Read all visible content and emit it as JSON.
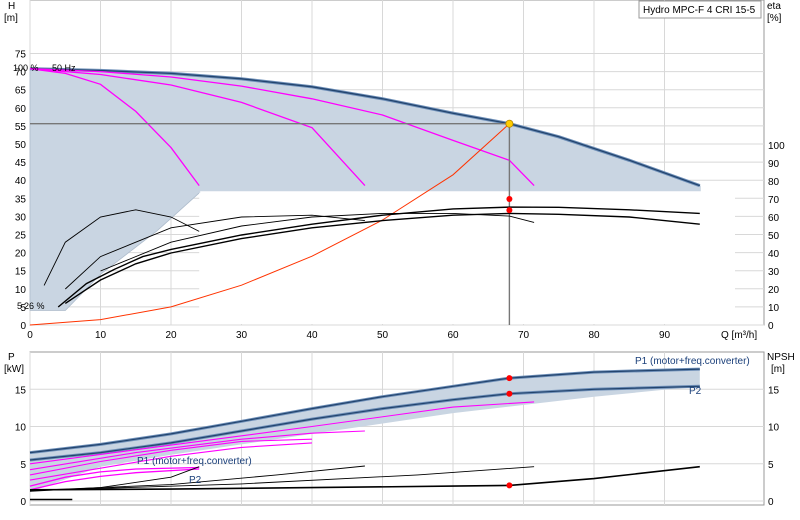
{
  "title": "Hydro MPC-F 4 CRI 15-5",
  "colors": {
    "envelope": "#c9d5e2",
    "envelope_stroke": "#aebccc",
    "main_curve": "#22446e",
    "main_curve_light": "#6e8fb8",
    "reduced_speed": "#ff00ff",
    "system_curve": "#ff3300",
    "eta": "#000000",
    "duty_line": "#777777",
    "duty_point": "#ffcc00",
    "marker": "#ff0000",
    "label_blue": "#1a3f7a",
    "grid": "#d8d8d8"
  },
  "top_panel": {
    "left_label": "H",
    "left_unit": "[m]",
    "right_label": "eta",
    "right_unit": "[%]",
    "x_label": "Q [m³/h]",
    "speed_label": "100 %",
    "freq_label": "50 Hz",
    "min_speed_label": "26 %",
    "min_speed_prefix": "5"
  },
  "bottom_panel": {
    "left_label": "P",
    "left_unit": "[kW]",
    "right_label": "NPSH",
    "right_unit": "[m]",
    "p1_label_top": "P1 (motor+freq.converter)",
    "p2_label_top": "P2",
    "p1_label_low": "P1 (motor+freq.converter)",
    "p2_label_low": "P2"
  },
  "chart_data": [
    {
      "type": "line",
      "name": "head-and-efficiency",
      "x_label": "Q [m³/h]",
      "xlim": [
        0,
        100
      ],
      "x_ticks": [
        0,
        10,
        20,
        30,
        40,
        50,
        60,
        70,
        80,
        90
      ],
      "y_label": "H [m]",
      "ylim": [
        0,
        80
      ],
      "y_ticks": [
        0,
        5,
        10,
        15,
        20,
        25,
        30,
        35,
        40,
        45,
        50,
        55,
        60,
        65,
        70,
        75
      ],
      "y2_label": "eta [%]",
      "y2_range": [
        0,
        100
      ],
      "y2_ticks": [
        0,
        10,
        20,
        30,
        40,
        50,
        60,
        70,
        80,
        90,
        100
      ],
      "duty_point": {
        "q": 68,
        "h": 55.6
      },
      "head_curves": [
        {
          "kind": "full-speed",
          "points": [
            [
              0,
              70.8
            ],
            [
              10,
              70.3
            ],
            [
              20,
              69.5
            ],
            [
              30,
              68.0
            ],
            [
              40,
              65.8
            ],
            [
              50,
              62.5
            ],
            [
              60,
              58.5
            ],
            [
              68,
              55.6
            ],
            [
              75,
              52
            ],
            [
              85,
              45.5
            ],
            [
              95,
              38.5
            ]
          ]
        },
        {
          "kind": "reduced",
          "points": [
            [
              0,
              70.8
            ],
            [
              10,
              70.0
            ],
            [
              20,
              68.5
            ],
            [
              30,
              66.0
            ],
            [
              40,
              62.5
            ],
            [
              50,
              58.0
            ],
            [
              60,
              51.0
            ],
            [
              68,
              45.5
            ],
            [
              71.5,
              38.5
            ]
          ]
        },
        {
          "kind": "reduced",
          "points": [
            [
              0,
              70.8
            ],
            [
              10,
              69.2
            ],
            [
              20,
              66.3
            ],
            [
              30,
              61.5
            ],
            [
              40,
              54.5
            ],
            [
              47.5,
              38.5
            ]
          ]
        },
        {
          "kind": "reduced",
          "points": [
            [
              0,
              70.8
            ],
            [
              5,
              69.5
            ],
            [
              10,
              66.5
            ],
            [
              15,
              59.0
            ],
            [
              20,
              49.0
            ],
            [
              24,
              38.5
            ]
          ]
        }
      ],
      "system_curve": [
        [
          0,
          0
        ],
        [
          10,
          1.5
        ],
        [
          20,
          5
        ],
        [
          30,
          11
        ],
        [
          40,
          19
        ],
        [
          50,
          29
        ],
        [
          60,
          41.5
        ],
        [
          68,
          55.6
        ]
      ],
      "eta_markers": [
        {
          "q": 68,
          "eta": 70
        },
        {
          "q": 68,
          "eta": 63.8
        }
      ],
      "eta_curves": [
        {
          "scale": "eta",
          "points": [
            [
              4,
              10
            ],
            [
              8,
              23
            ],
            [
              12,
              31
            ],
            [
              16,
              38
            ],
            [
              20,
              42
            ],
            [
              25,
              46
            ],
            [
              30,
              50
            ],
            [
              40,
              56
            ],
            [
              50,
              61
            ],
            [
              60,
              64.5
            ],
            [
              68,
              65.5
            ],
            [
              75,
              65.4
            ],
            [
              85,
              64
            ],
            [
              95,
              62
            ]
          ]
        },
        {
          "scale": "eta",
          "points": [
            [
              5,
              12
            ],
            [
              10,
              25
            ],
            [
              15,
              34
            ],
            [
              20,
              40
            ],
            [
              30,
              48
            ],
            [
              40,
              54
            ],
            [
              50,
              58
            ],
            [
              60,
              61
            ],
            [
              68,
              62
            ],
            [
              75,
              61.5
            ],
            [
              85,
              60
            ],
            [
              95,
              56
            ]
          ]
        },
        {
          "scale": "eta",
          "points": [
            [
              10,
              30
            ],
            [
              20,
              46
            ],
            [
              30,
              55
            ],
            [
              40,
              60
            ],
            [
              50,
              62
            ],
            [
              60,
              62
            ],
            [
              68,
              60.5
            ],
            [
              71.5,
              57
            ]
          ]
        },
        {
          "scale": "eta",
          "points": [
            [
              5,
              20
            ],
            [
              10,
              38
            ],
            [
              20,
              54
            ],
            [
              30,
              60
            ],
            [
              40,
              61
            ],
            [
              47.5,
              58
            ]
          ]
        },
        {
          "scale": "eta",
          "points": [
            [
              2,
              22
            ],
            [
              5,
              46
            ],
            [
              10,
              60
            ],
            [
              15,
              64
            ],
            [
              20,
              60
            ],
            [
              24,
              52
            ]
          ]
        }
      ]
    },
    {
      "type": "line",
      "name": "power-and-npsh",
      "x_label": "Q [m³/h]",
      "xlim": [
        0,
        100
      ],
      "y_label": "P [kW]",
      "ylim": [
        0,
        20
      ],
      "y_ticks": [
        0,
        5,
        10,
        15
      ],
      "y2_label": "NPSH [m]",
      "y2_ticks": [
        0,
        5,
        10,
        15
      ],
      "markers": [
        {
          "q": 68,
          "p": 16.5
        },
        {
          "q": 68,
          "p": 14.4
        },
        {
          "q": 68,
          "npsh": 2.1
        }
      ],
      "series": [
        {
          "name": "P1 (motor+freq.converter)",
          "kind": "full-speed",
          "points": [
            [
              0,
              6.5
            ],
            [
              10,
              7.6
            ],
            [
              20,
              9.0
            ],
            [
              30,
              10.7
            ],
            [
              40,
              12.4
            ],
            [
              50,
              14.0
            ],
            [
              60,
              15.4
            ],
            [
              68,
              16.5
            ],
            [
              80,
              17.3
            ],
            [
              95,
              17.7
            ]
          ]
        },
        {
          "name": "P2",
          "kind": "full-speed",
          "points": [
            [
              0,
              5.5
            ],
            [
              10,
              6.5
            ],
            [
              20,
              7.8
            ],
            [
              30,
              9.4
            ],
            [
              40,
              11.0
            ],
            [
              50,
              12.4
            ],
            [
              60,
              13.6
            ],
            [
              68,
              14.4
            ],
            [
              80,
              15.0
            ],
            [
              95,
              15.4
            ]
          ]
        },
        {
          "kind": "reduced",
          "points": [
            [
              0,
              5.0
            ],
            [
              20,
              7.5
            ],
            [
              40,
              10.0
            ],
            [
              60,
              12.6
            ],
            [
              71.5,
              13.3
            ]
          ]
        },
        {
          "kind": "reduced",
          "points": [
            [
              0,
              4.2
            ],
            [
              15,
              6.5
            ],
            [
              30,
              8.3
            ],
            [
              40,
              9.1
            ],
            [
              47.5,
              9.4
            ]
          ]
        },
        {
          "kind": "reduced",
          "points": [
            [
              0,
              3.5
            ],
            [
              10,
              5.3
            ],
            [
              20,
              6.8
            ],
            [
              30,
              8.0
            ],
            [
              40,
              8.3
            ]
          ]
        },
        {
          "kind": "reduced",
          "points": [
            [
              0,
              2.8
            ],
            [
              10,
              4.4
            ],
            [
              20,
              6.0
            ],
            [
              30,
              7.2
            ],
            [
              40,
              7.8
            ]
          ]
        },
        {
          "name": "P1 (motor+freq.converter)",
          "kind": "min-speed",
          "points": [
            [
              0,
              2.0
            ],
            [
              5,
              3.2
            ],
            [
              10,
              3.9
            ],
            [
              15,
              4.3
            ],
            [
              24,
              4.5
            ]
          ]
        },
        {
          "name": "P2",
          "kind": "min-speed",
          "points": [
            [
              0,
              1.5
            ],
            [
              5,
              2.6
            ],
            [
              10,
              3.3
            ],
            [
              15,
              3.8
            ],
            [
              24,
              4.3
            ]
          ]
        },
        {
          "kind": "npsh",
          "points": [
            [
              0,
              1.5
            ],
            [
              20,
              1.6
            ],
            [
              40,
              1.8
            ],
            [
              60,
              2.0
            ],
            [
              68,
              2.1
            ],
            [
              80,
              3.0
            ],
            [
              95,
              4.6
            ]
          ]
        },
        {
          "kind": "npsh",
          "points": [
            [
              0,
              1.4
            ],
            [
              20,
              2.2
            ],
            [
              35,
              3.5
            ],
            [
              47.5,
              4.7
            ]
          ]
        },
        {
          "kind": "npsh",
          "points": [
            [
              0,
              1.4
            ],
            [
              30,
              2.3
            ],
            [
              55,
              3.5
            ],
            [
              71.5,
              4.6
            ]
          ]
        },
        {
          "kind": "npsh",
          "points": [
            [
              0,
              1.3
            ],
            [
              10,
              1.8
            ],
            [
              20,
              3.2
            ],
            [
              24,
              4.6
            ]
          ]
        }
      ]
    }
  ]
}
